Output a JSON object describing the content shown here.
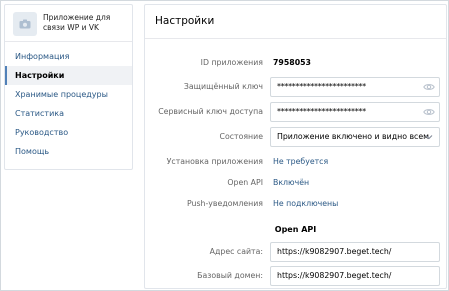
{
  "app": {
    "name": "Приложение для связи WP и VK"
  },
  "sidebar": {
    "items": [
      {
        "label": "Информация"
      },
      {
        "label": "Настройки"
      },
      {
        "label": "Хранимые процедуры"
      },
      {
        "label": "Статистика"
      },
      {
        "label": "Руководство"
      },
      {
        "label": "Помощь"
      }
    ]
  },
  "main": {
    "title": "Настройки",
    "app_id_label": "ID приложения",
    "app_id_value": "7958053",
    "secure_key_label": "Защищённый ключ",
    "secure_key_value": "************************",
    "service_key_label": "Сервисный ключ доступа",
    "service_key_value": "************************",
    "state_label": "Состояние",
    "state_value": "Приложение включено и видно всем",
    "install_label": "Установка приложения",
    "install_value": "Не требуется",
    "openapi_label": "Open API",
    "openapi_value": "Включён",
    "push_label": "Push-уведомления",
    "push_value": "Не подключены",
    "openapi_section_title": "Open API",
    "site_label": "Адрес сайта:",
    "site_value": "https://k9082907.beget.tech/",
    "domain_label": "Базовый домен:",
    "domain_value": "https://k9082907.beget.tech/"
  },
  "colors": {
    "link": "#2a5885",
    "accent": "#5181b8",
    "border": "#d3d9de",
    "label": "#656565"
  },
  "icons": [
    "camera-icon",
    "eye-icon",
    "chevron-down-icon"
  ]
}
